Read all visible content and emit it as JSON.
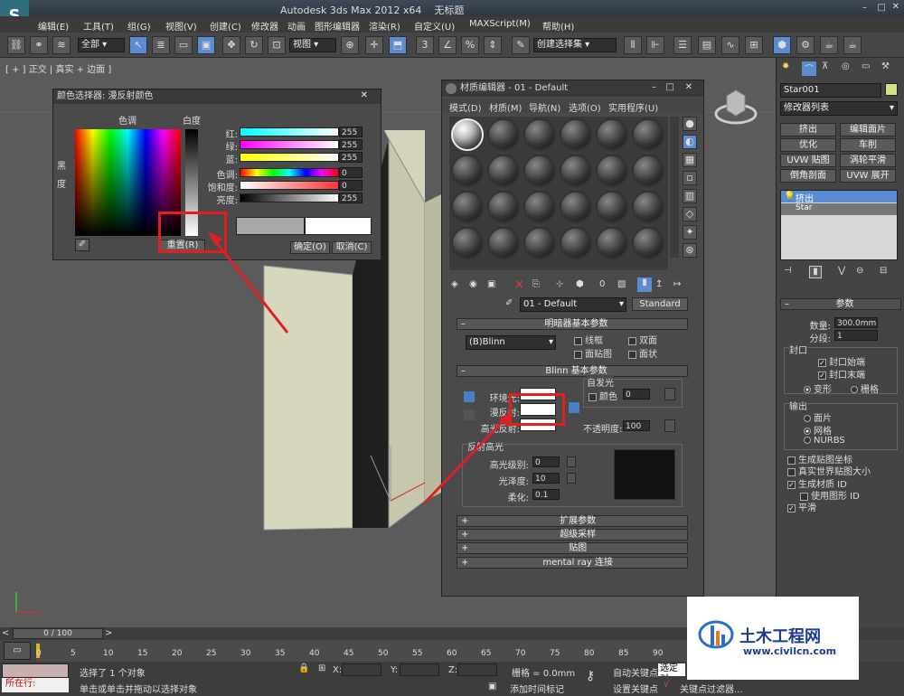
{
  "app": {
    "title": "Autodesk 3ds Max  2012 x64",
    "file": "无标题",
    "logo": "S"
  },
  "menu": [
    "编辑(E)",
    "工具(T)",
    "组(G)",
    "视图(V)",
    "创建(C)",
    "修改器",
    "动画",
    "图形编辑器",
    "渲染(R)",
    "自定义(U)",
    "MAXScript(M)",
    "帮助(H)"
  ],
  "toolbar": {
    "filter": "全部",
    "view": "视图",
    "selection_set": "创建选择集",
    "snap": "3"
  },
  "viewport": {
    "label": "[ + ] 正交 | 真实 + 边面 ]"
  },
  "color_picker": {
    "title": "颜色选择器: 漫反射颜色",
    "hue_label": "色调",
    "white_label": "白度",
    "black_label": "黑",
    "deg_label": "度",
    "channels": [
      {
        "label": "红:",
        "value": "255",
        "color": "#ff00ff"
      },
      {
        "label": "绿:",
        "value": "255",
        "color": "#00ffff"
      },
      {
        "label": "蓝:",
        "value": "255",
        "color": "#ffff00"
      },
      {
        "label": "色调:",
        "value": "0",
        "color": "#ff0000"
      },
      {
        "label": "饱和度:",
        "value": "0",
        "color": "#ff4444"
      },
      {
        "label": "亮度:",
        "value": "255",
        "color": "#ffffff"
      }
    ],
    "reset": "重置(R)",
    "ok": "确定(O)",
    "cancel": "取消(C)"
  },
  "material_editor": {
    "title": "材质编辑器 - 01 - Default",
    "menu": [
      "模式(D)",
      "材质(M)",
      "导航(N)",
      "选项(O)",
      "实用程序(U)"
    ],
    "material_name": "01 - Default",
    "material_type": "Standard",
    "shader_rollup": "明暗器基本参数",
    "shader": "(B)Blinn",
    "shader_opts": [
      "线框",
      "双面",
      "面贴图",
      "面状"
    ],
    "blinn_rollup": "Blinn 基本参数",
    "self_illum": "自发光",
    "color_label": "颜色",
    "color_val": "0",
    "ambient": "环境光:",
    "diffuse": "漫反射:",
    "specular": "高光反射:",
    "opacity_label": "不透明度:",
    "opacity": "100",
    "spec_group": "反射高光",
    "spec_level_label": "高光级别:",
    "spec_level": "0",
    "gloss_label": "光泽度:",
    "gloss": "10",
    "soften_label": "柔化:",
    "soften": "0.1",
    "rollups": [
      "扩展参数",
      "超级采样",
      "贴图",
      "mental ray 连接"
    ]
  },
  "command_panel": {
    "object": "Star001",
    "modifier_list": "修改器列表",
    "buttons": [
      "挤出",
      "编辑面片",
      "优化",
      "车削",
      "UVW 贴图",
      "涡轮平滑",
      "倒角剖面",
      "UVW 展开"
    ],
    "stack": [
      "挤出",
      "Star"
    ],
    "params_title": "参数",
    "amount_label": "数量:",
    "amount": "300.0mm",
    "segments_label": "分段:",
    "segments": "1",
    "capping": "封口",
    "cap_start": "封口始端",
    "cap_end": "封口末端",
    "morph": "变形",
    "grid": "栅格",
    "output": "输出",
    "patch": "面片",
    "mesh": "网格",
    "nurbs": "NURBS",
    "gen_map": "生成贴图坐标",
    "real_world": "真实世界贴图大小",
    "gen_mat": "生成材质 ID",
    "use_shape": "使用图形 ID",
    "smooth": "平滑"
  },
  "timeline": {
    "frame": "0 / 100",
    "ticks": [
      "0",
      "5",
      "10",
      "15",
      "20",
      "25",
      "30",
      "35",
      "40",
      "45",
      "50",
      "55",
      "60",
      "65",
      "70",
      "75",
      "80",
      "85",
      "90"
    ]
  },
  "status": {
    "selected": "选择了 1 个对象",
    "hint": "单击或单击并拖动以选择对象",
    "x": "X:",
    "y": "Y:",
    "z": "Z:",
    "grid": "栅格 = 0.0mm",
    "auto_key": "自动关键点",
    "set_key": "设置关键点",
    "selected_obj": "选定对",
    "add_time": "添加时间标记",
    "key_filter": "关键点过滤器...",
    "running": "所在行:"
  },
  "watermark": {
    "brand": "土木工程网",
    "url": "www.civilcn.com"
  },
  "colors": {
    "accent_red": "#e02020",
    "viewport_bg": "#5b5b5b"
  }
}
